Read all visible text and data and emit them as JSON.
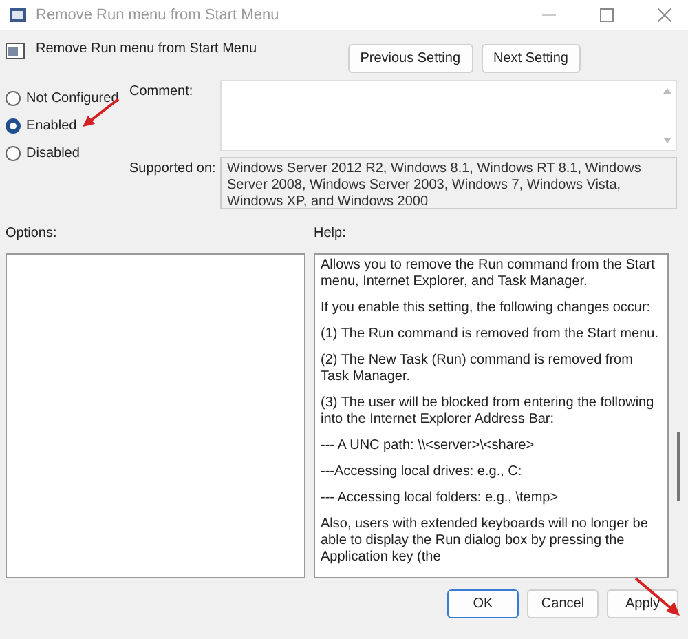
{
  "window": {
    "title": "Remove Run menu from Start Menu"
  },
  "setting": {
    "title": "Remove Run menu from Start Menu"
  },
  "nav_buttons": [
    "Previous Setting",
    "Next Setting"
  ],
  "states": [
    {
      "label": "Not Configured",
      "selected": false
    },
    {
      "label": "Enabled",
      "selected": true
    },
    {
      "label": "Disabled",
      "selected": false
    }
  ],
  "comment": {
    "label": "Comment:"
  },
  "supported_on": {
    "label": "Supported on:",
    "text": "Windows Server 2012 R2, Windows 8.1, Windows RT 8.1, Windows Server 2008, Windows Server 2003, Windows 7, Windows Vista, Windows XP, and Windows 2000"
  },
  "options": {
    "label": "Options:"
  },
  "help": {
    "label": "Help:",
    "paragraphs": [
      "Allows you to remove the Run command from the Start menu, Internet Explorer, and Task Manager.",
      "If you enable this setting, the following changes occur:",
      "(1) The Run command is removed from the Start menu.",
      "(2) The New Task (Run) command is removed from Task Manager.",
      "(3) The user will be blocked from entering the following into the Internet Explorer Address Bar:",
      "--- A UNC path: \\\\<server>\\<share>",
      "---Accessing local drives:  e.g., C:",
      "--- Accessing local folders: e.g., \\temp>",
      "Also, users with extended keyboards will no longer be able to display the Run dialog box by pressing the Application key (the"
    ]
  },
  "buttons": [
    {
      "label": "OK",
      "default": true
    },
    {
      "label": "Cancel",
      "default": false
    },
    {
      "label": "Apply",
      "default": false
    }
  ]
}
